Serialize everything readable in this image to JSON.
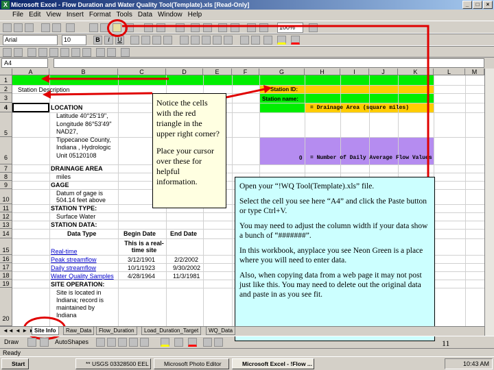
{
  "window": {
    "title": "Microsoft Excel - Flow Duration and Water Quality Tool(Template).xls  [Read-Only]",
    "app_icon": "excel-icon"
  },
  "menu": [
    "File",
    "Edit",
    "View",
    "Insert",
    "Format",
    "Tools",
    "Data",
    "Window",
    "Help"
  ],
  "toolbar": {
    "font_name": "Arial",
    "font_size": "10",
    "zoom": "100%"
  },
  "name_box": "A4",
  "columns": [
    "A",
    "B",
    "C",
    "D",
    "E",
    "F",
    "G",
    "H",
    "I",
    "J",
    "K",
    "L",
    "M"
  ],
  "rows": [
    "1",
    "2",
    "3",
    "4",
    "5",
    "6",
    "7",
    "8",
    "9",
    "10",
    "11",
    "12",
    "13",
    "14",
    "15",
    "16",
    "17",
    "18",
    "19",
    "20"
  ],
  "cells": {
    "a2": "Station Description",
    "b4": "LOCATION",
    "b5": [
      "Latitude 40°25'19\",",
      "Longitude 86°53'49\"",
      "NAD27,",
      "Tippecanoe County,",
      "Indiana , Hydrologic",
      "Unit 05120108"
    ],
    "b7": "DRAINAGE AREA",
    "b8": "miles",
    "b9": "GAGE",
    "b10": [
      "Datum of gage is",
      "504.14 feet above"
    ],
    "b11": "STATION TYPE:",
    "b12": "Surface Water",
    "b13": "STATION DATA:",
    "hdr_data_type": "Data Type",
    "hdr_begin_date": "Begin Date",
    "hdr_end_date": "End Date",
    "realtime_note": [
      "This is a real-",
      "time site"
    ],
    "data_rows": [
      {
        "type": "Real-time",
        "begin": "",
        "end": ""
      },
      {
        "type": "Peak streamflow",
        "begin": "3/12/1901",
        "end": "2/2/2002"
      },
      {
        "type": "Daily streamflow",
        "begin": "10/1/1923",
        "end": "9/30/2002"
      },
      {
        "type": "Water Quality Samples",
        "begin": "4/28/1964",
        "end": "11/3/1981"
      }
    ],
    "b19": "SITE OPERATION:",
    "b20": [
      "Site is located in",
      "Indiana; record is",
      "maintained by",
      "Indiana"
    ],
    "station_id_label": "Station ID:",
    "station_name_label": "Station name:",
    "drainage_area_label": "= Drainage Area  (square miles)",
    "zero_value": "0",
    "flow_values_label": "= Number of Daily Average Flow Values"
  },
  "note_box": {
    "para1": "Notice the cells with the red triangle in the upper right corner?",
    "para2": "Place your cursor over these for helpful information."
  },
  "instructions": {
    "p1": "Open your “!WQ Tool(Template).xls” file.",
    "p2": "Select the cell you see here “A4” and click the Paste button or type Ctrl+V.",
    "p3": "You may need to adjust the column width if your data show a bunch of “#######”.",
    "p4": "In this workbook, anyplace you see Neon Green is a place where you will need to enter data.",
    "p5": "Also, when copying data from a web page it may not post just like this.  You may need to delete out the original data and paste in as you see fit."
  },
  "sheet_tabs": [
    "Site Info",
    "Raw_Data",
    "Flow_Duration",
    "Load_Duration_Target",
    "WQ_Data"
  ],
  "drawbar": {
    "draw_label": "Draw",
    "autoshapes_label": "AutoShapes"
  },
  "status": "Ready",
  "slide_number": "11",
  "taskbar": {
    "start_label": "Start",
    "items": [
      "** USGS 03328500 EEL R...",
      "Microsoft Photo Editor",
      "Microsoft Excel - !Flow ..."
    ],
    "clock": "10:43 AM"
  },
  "colors": {
    "neon_green": "#00ee00",
    "yellow": "#ffcc00",
    "purple": "#b58cf0",
    "callout": "#ccffff",
    "annotation_red": "#e00000"
  }
}
